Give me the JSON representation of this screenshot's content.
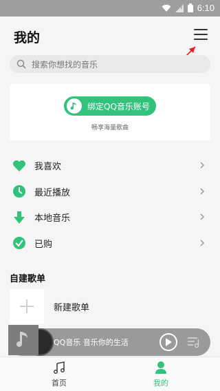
{
  "status": {
    "time": "6:10"
  },
  "header": {
    "title": "我的"
  },
  "search": {
    "placeholder": "搜索你想找的音乐"
  },
  "card": {
    "button_label": "绑定QQ音乐账号",
    "subtitle": "畅享海量歌曲"
  },
  "menu": {
    "items": [
      {
        "label": "我喜欢",
        "icon": "heart-icon"
      },
      {
        "label": "最近播放",
        "icon": "clock-icon"
      },
      {
        "label": "本地音乐",
        "icon": "download-arrow-icon"
      },
      {
        "label": "已购",
        "icon": "check-circle-icon"
      }
    ]
  },
  "playlists": {
    "section_title": "自建歌单",
    "new_label": "新建歌单"
  },
  "player": {
    "text": "QQ音乐 音乐你的生活"
  },
  "tabs": {
    "home": "首页",
    "mine": "我的"
  },
  "colors": {
    "accent": "#31c27c",
    "annotation": "#e02020"
  }
}
